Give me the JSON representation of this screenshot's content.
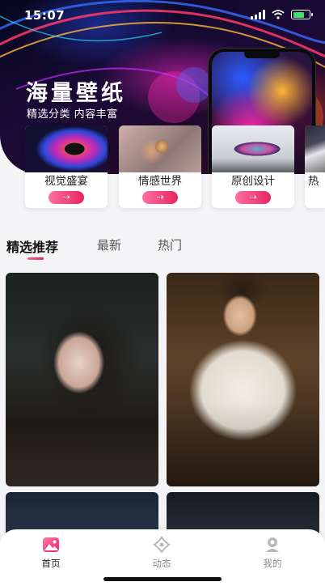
{
  "status_bar": {
    "time": "15:07"
  },
  "hero": {
    "title": "海量壁纸",
    "subtitle": "精选分类  内容丰富"
  },
  "categories": [
    {
      "label": "视觉盛宴",
      "action": "⇢"
    },
    {
      "label": "情感世界",
      "action": "⇢"
    },
    {
      "label": "原创设计",
      "action": "⇢"
    },
    {
      "label": "热",
      "action": ""
    }
  ],
  "tabs": [
    {
      "label": "精选推荐",
      "active": true
    },
    {
      "label": "最新",
      "active": false
    },
    {
      "label": "热门",
      "active": false
    }
  ],
  "bottom_nav": [
    {
      "label": "首页",
      "icon": "image-icon",
      "active": true
    },
    {
      "label": "动态",
      "icon": "sparkle-icon",
      "active": false
    },
    {
      "label": "我的",
      "icon": "user-icon",
      "active": false
    }
  ],
  "colors": {
    "accent": "#e8265e",
    "accent_light": "#ff6fa0",
    "battery": "#3ce06a"
  }
}
